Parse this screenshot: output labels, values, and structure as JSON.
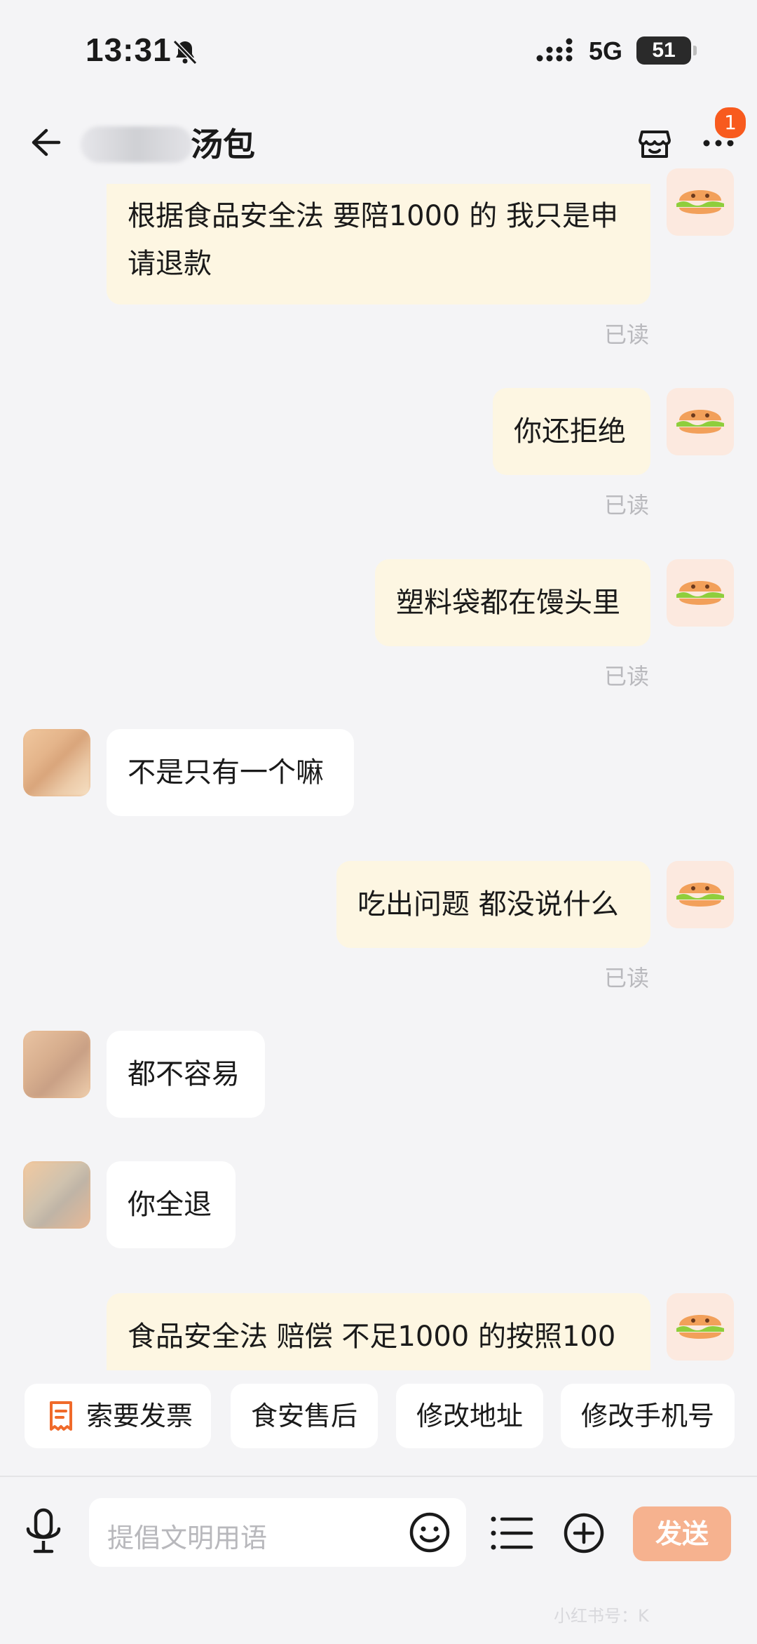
{
  "status_bar": {
    "time": "13:31",
    "network": "5G",
    "battery": "51"
  },
  "header": {
    "title": "汤包",
    "notification_count": "1"
  },
  "messages": [
    {
      "side": "out",
      "text": "根据食品安全法 要陪1000 的 我只是申请退款",
      "status": "已读"
    },
    {
      "side": "out",
      "text": "你还拒绝",
      "status": "已读"
    },
    {
      "side": "out",
      "text": "塑料袋都在馒头里",
      "status": "已读"
    },
    {
      "side": "in",
      "text": "不是只有一个嘛"
    },
    {
      "side": "out",
      "text": "吃出问题 都没说什么",
      "status": "已读"
    },
    {
      "side": "in",
      "text": "都不容易"
    },
    {
      "side": "in",
      "text": "你全退"
    },
    {
      "side": "out",
      "text": "食品安全法 赔偿 不足1000 的按照100"
    }
  ],
  "quick_actions": [
    "索要发票",
    "食安售后",
    "修改地址",
    "修改手机号"
  ],
  "composer": {
    "placeholder": "提倡文明用语",
    "send_label": "发送"
  },
  "watermark": "小红书号：K",
  "colors": {
    "accent": "#f85a1e",
    "send_button": "#f6b28f",
    "outgoing_bubble": "#fdf6e2"
  }
}
